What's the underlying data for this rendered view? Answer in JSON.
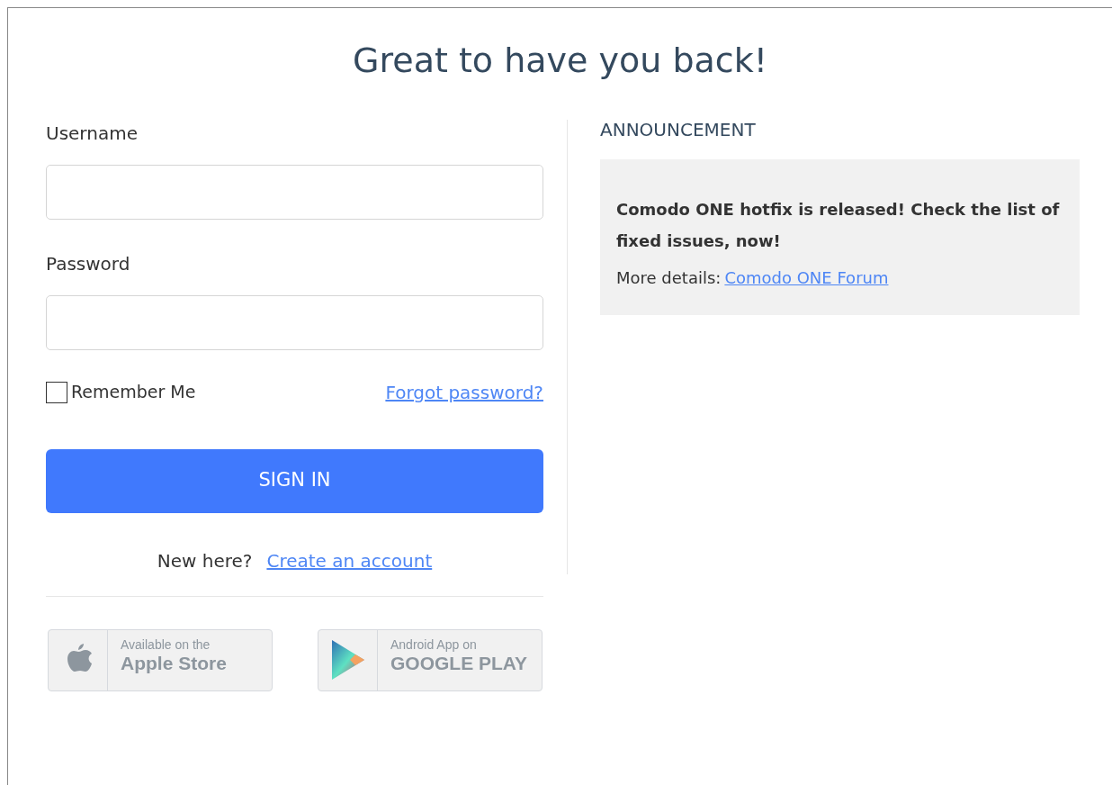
{
  "heading": "Great to have you back!",
  "form": {
    "fields": [
      {
        "label": "Username"
      },
      {
        "label": "Password"
      }
    ],
    "remember": {
      "label": "Remember Me",
      "checked": false
    },
    "forgot_link": "Forgot password?",
    "submit": "SIGN IN",
    "signup": {
      "text": "New here?",
      "link": "Create an account"
    }
  },
  "store_badges": [
    {
      "kind": "apple",
      "line_1": "Available on the",
      "line_2": "Apple Store"
    },
    {
      "kind": "google",
      "line_1": "Android App on",
      "line_2": "GOOGLE PLAY"
    }
  ],
  "announcement": {
    "title": "ANNOUNCEMENT",
    "message": "Comodo ONE hotfix is released! Check the list of fixed issues, now!",
    "details_label": "More details:",
    "details_link": "Comodo ONE Forum"
  }
}
